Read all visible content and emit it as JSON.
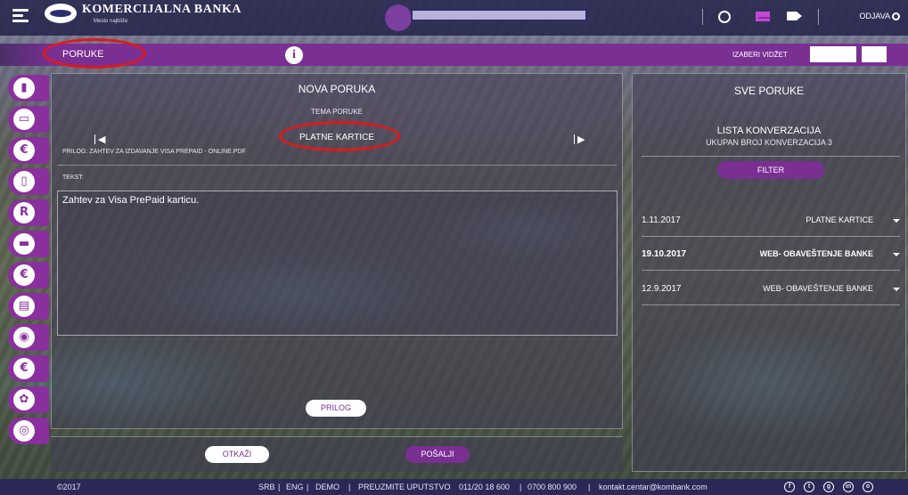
{
  "brand": {
    "name": "KOMERCIJALNA BANKA",
    "tagline": "Mesto najbliže"
  },
  "topbar": {
    "logout_label": "ODJAVA"
  },
  "ribbon": {
    "section_title": "PORUKE",
    "info_symbol": "i",
    "widget_label": "IZABERI VIDŽET"
  },
  "sidebar": {
    "items": [
      {
        "name": "dashboard",
        "glyph": "▮"
      },
      {
        "name": "accounts",
        "glyph": "▭"
      },
      {
        "name": "payments",
        "glyph": "€"
      },
      {
        "name": "cards",
        "glyph": "▯"
      },
      {
        "name": "exchange",
        "glyph": "R"
      },
      {
        "name": "loans",
        "glyph": "▬"
      },
      {
        "name": "euro",
        "glyph": "€"
      },
      {
        "name": "savings",
        "glyph": "▤"
      },
      {
        "name": "locations",
        "glyph": "◉"
      },
      {
        "name": "currency",
        "glyph": "€"
      },
      {
        "name": "settings",
        "glyph": "✿"
      },
      {
        "name": "other",
        "glyph": "◎"
      }
    ]
  },
  "new_message": {
    "title": "NOVA PORUKA",
    "topic_label": "TEMA PORUKE",
    "topic_value": "PLATNE KARTICE",
    "attachment_line": "PRILOG: ZAHTEV ZA IZDAVANJE VISA PREPAID - ONLINE.PDF",
    "text_label": "TEKST:",
    "message_text": "Zahtev za Visa PrePaid karticu.",
    "attach_button": "PRILOG",
    "cancel_button": "OTKAŽI",
    "send_button": "POŠALJI"
  },
  "all_messages": {
    "title": "SVE PORUKE",
    "list_title": "LISTA KONVERZACIJA",
    "count_line": "UKUPAN BROJ KONVERZACIJA 3",
    "filter_button": "FILTER",
    "conversations": [
      {
        "date": "1.11.2017",
        "topic": "PLATNE KARTICE",
        "bold": false
      },
      {
        "date": "19.10.2017",
        "topic": "WEB- OBAVEŠTENJE BANKE",
        "bold": true
      },
      {
        "date": "12.9.2017",
        "topic": "WEB- OBAVEŠTENJE BANKE",
        "bold": false
      }
    ]
  },
  "footer": {
    "copyright": "©2017",
    "lang_srb": "SRB",
    "lang_eng": "ENG",
    "demo": "DEMO",
    "download_guide": "PREUZMITE UPUTSTVO",
    "phone1": "011/20 18 600",
    "phone2": "0700 800 900",
    "email": "kontakt.centar@kombank.com",
    "social": [
      "f",
      "t",
      "g",
      "in",
      "o"
    ]
  },
  "colors": {
    "brand_purple": "#7a2f93",
    "annotation_red": "#e01818",
    "topbar_navy": "#1e1e46"
  }
}
